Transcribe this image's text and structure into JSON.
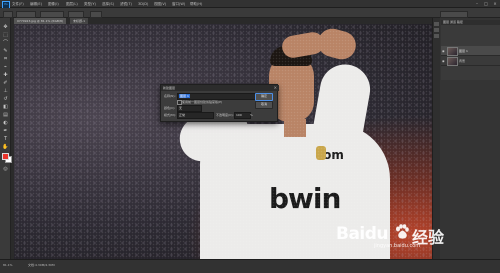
{
  "app": {
    "logo_text": "Ps"
  },
  "menu": {
    "items": [
      "文件(F)",
      "编辑(E)",
      "图像(I)",
      "图层(L)",
      "类型(Y)",
      "选择(S)",
      "滤镜(T)",
      "3D(D)",
      "视图(V)",
      "窗口(W)",
      "帮助(H)"
    ]
  },
  "tabs": [
    {
      "label": "0770923.jpg @ 81.1% (RGB/8)"
    },
    {
      "label": "未标题-1"
    }
  ],
  "dialog": {
    "title": "新建图层",
    "close": "×",
    "name_label": "名称(N):",
    "name_value": "图层 1",
    "clip_label": "使用前一图层创建剪贴蒙版(P)",
    "color_label": "颜色(C):",
    "color_value": "无",
    "mode_label": "模式(M):",
    "mode_value": "正常",
    "opacity_label": "不透明度(O):",
    "opacity_value": "100",
    "opacity_unit": "%",
    "ok": "确定",
    "cancel": "取消"
  },
  "layers": {
    "panel_tabs": "图层  通道  路径",
    "rows": [
      {
        "name": "图层 1"
      },
      {
        "name": "背景"
      }
    ]
  },
  "status": {
    "zoom": "81.1%",
    "doc": "文档:4.30M/4.30M"
  },
  "watermark": {
    "brand": "Baidu",
    "cn": "经验",
    "url": "jingyan.baidu.com"
  },
  "colors": {
    "foreground": "#e9342b",
    "background": "#ffffff",
    "accent": "#2f6fd6"
  }
}
